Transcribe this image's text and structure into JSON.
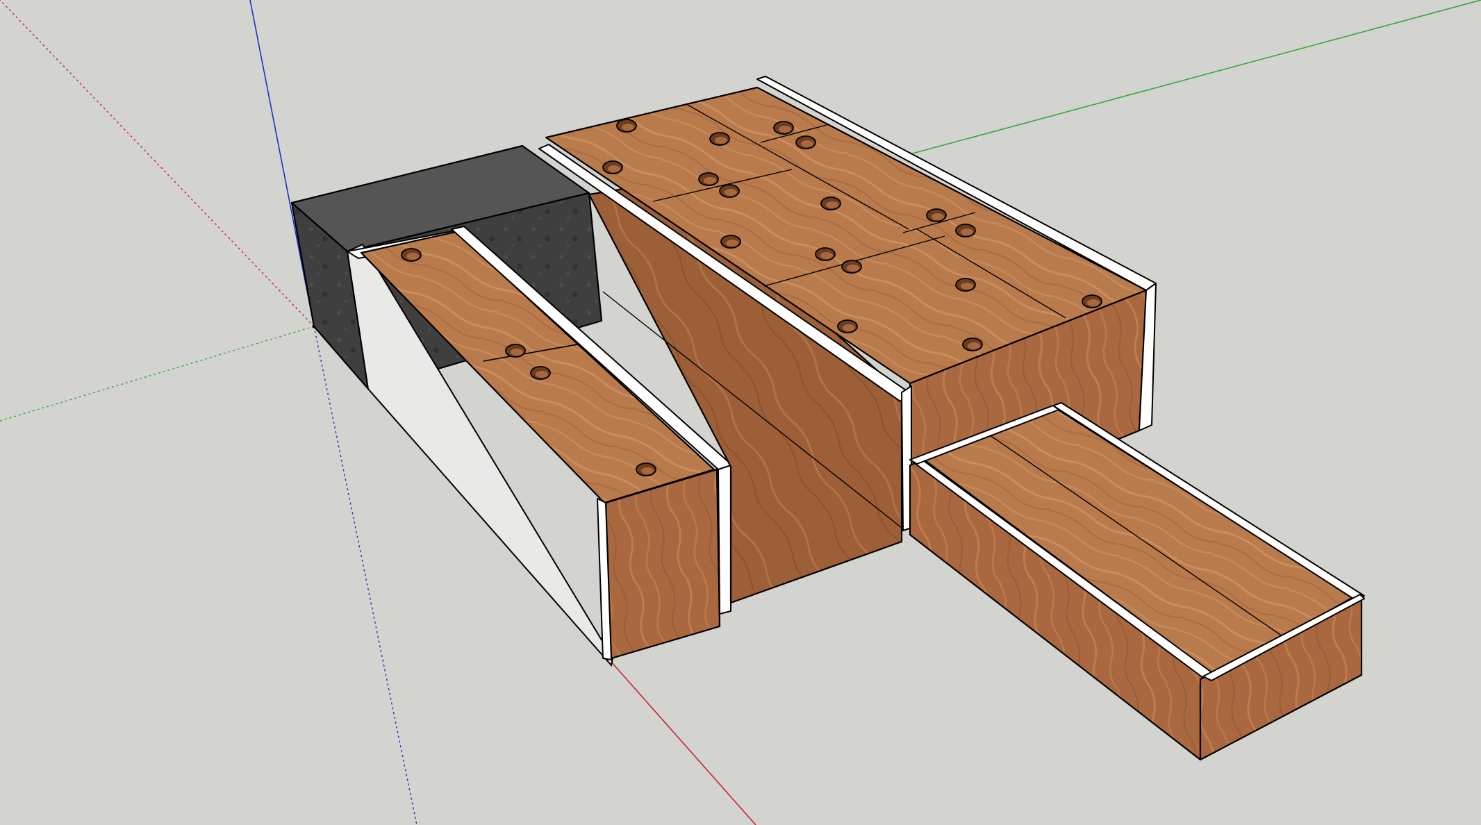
{
  "viewport": {
    "background": "#d3d3cf"
  },
  "axes": {
    "red": "#c8262a",
    "green": "#3aa83a",
    "blue": "#1f2fc8"
  },
  "materials": {
    "wood_top": "#b97a4c",
    "wood_side": "#a9683f",
    "wood_dark": "#8f5632",
    "wood_grain": "#d49a6a",
    "panel_white": "#ffffff",
    "panel_grey": "#e9e9e7",
    "block_top": "#4b4b4b",
    "block_front": "#3a3a3a",
    "block_side": "#2e2e2e"
  },
  "icons": [
    "axis-origin-icon"
  ]
}
